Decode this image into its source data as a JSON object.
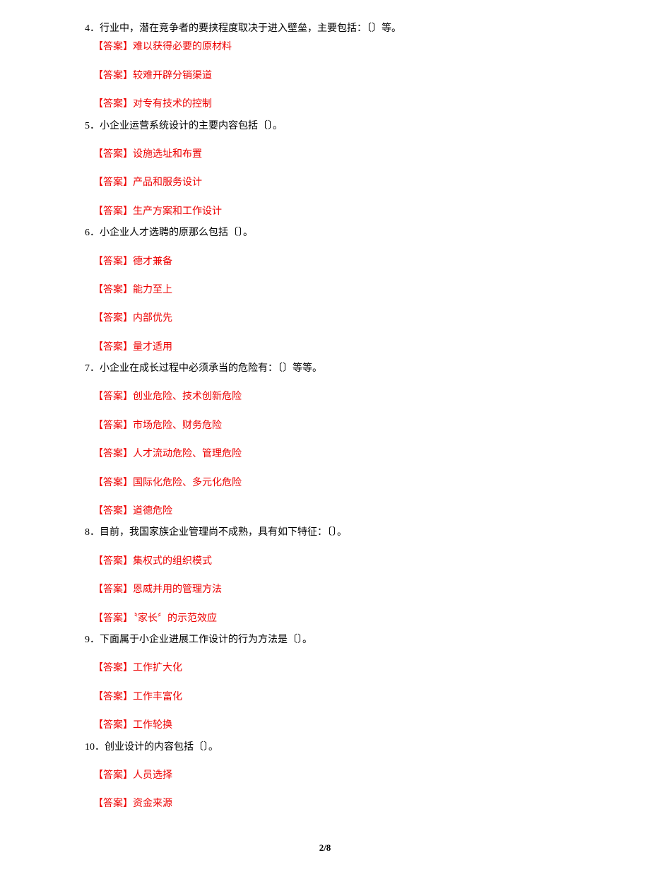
{
  "answer_label": "【答案】",
  "questions": [
    {
      "num": "4．",
      "text": "行业中，潜在竞争者的要挟程度取决于进入壁垒，主要包括：〔〕等。",
      "answers": [
        "难以获得必要的原材料",
        "较难开辟分销渠道",
        "对专有技术的控制"
      ],
      "first": true
    },
    {
      "num": "5．",
      "text": "小企业运营系统设计的主要内容包括〔〕。",
      "answers": [
        "设施选址和布置",
        "产品和服务设计",
        "生产方案和工作设计"
      ]
    },
    {
      "num": "6．",
      "text": "小企业人才选聘的原那么包括〔〕。",
      "answers": [
        "德才兼备",
        "能力至上",
        "内部优先",
        "量才适用"
      ]
    },
    {
      "num": "7．",
      "text": "小企业在成长过程中必须承当的危险有：〔〕等等。",
      "answers": [
        "创业危险、技术创新危险",
        "市场危险、财务危险",
        "人才流动危险、管理危险",
        "国际化危险、多元化危险",
        "道德危险"
      ]
    },
    {
      "num": "8．",
      "text": "目前，我国家族企业管理尚不成熟，具有如下特征：〔〕。",
      "answers": [
        "集权式的组织模式",
        "恩威并用的管理方法",
        "〝家长〞的示范效应"
      ]
    },
    {
      "num": "9．",
      "text": "下面属于小企业进展工作设计的行为方法是〔〕。",
      "answers": [
        "工作扩大化",
        "工作丰富化",
        "工作轮换"
      ]
    },
    {
      "num": "10．",
      "text": "创业设计的内容包括〔〕。",
      "answers": [
        "人员选择",
        "资金来源"
      ]
    }
  ],
  "page_number": "2/8"
}
